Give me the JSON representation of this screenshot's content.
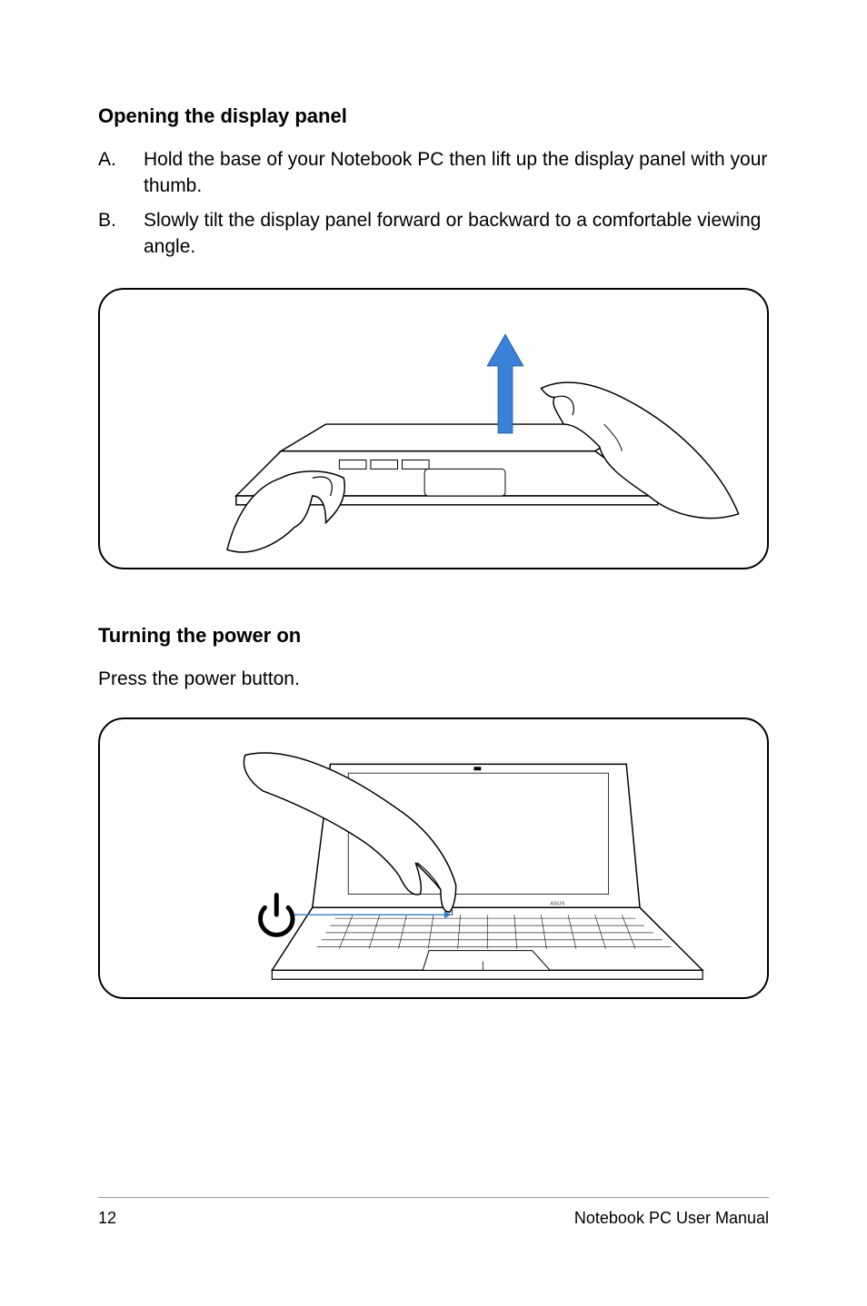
{
  "sections": {
    "opening": {
      "heading": "Opening the display panel",
      "steps": [
        {
          "marker": "A.",
          "text": "Hold the base of your Notebook PC then lift up the display panel with your thumb."
        },
        {
          "marker": "B.",
          "text": "Slowly tilt the display panel forward or backward to a comfortable viewing angle."
        }
      ]
    },
    "poweron": {
      "heading": "Turning the power on",
      "body": "Press the power button."
    }
  },
  "footer": {
    "page": "12",
    "doc": "Notebook PC User Manual"
  }
}
